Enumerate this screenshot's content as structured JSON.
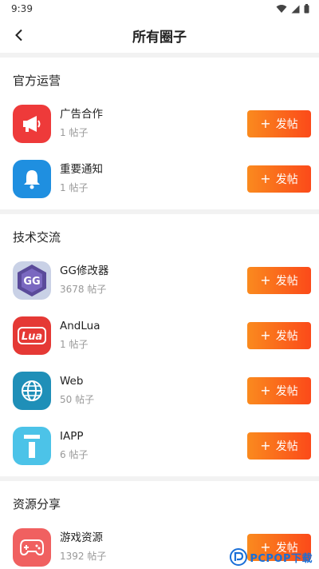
{
  "status": {
    "time": "9:39"
  },
  "header": {
    "title": "所有圈子"
  },
  "sections": [
    {
      "title": "官方运营",
      "items": [
        {
          "name": "广告合作",
          "count": "1 帖子",
          "button": "发帖",
          "icon": "megaphone-icon",
          "color": "#ee3a3a"
        },
        {
          "name": "重要通知",
          "count": "1 帖子",
          "button": "发帖",
          "icon": "bell-icon",
          "color": "#1f8fe0"
        }
      ]
    },
    {
      "title": "技术交流",
      "items": [
        {
          "name": "GG修改器",
          "count": "3678 帖子",
          "button": "发帖",
          "icon": "gg-logo-icon",
          "color": "#5a4a9a"
        },
        {
          "name": "AndLua",
          "count": "1 帖子",
          "button": "发帖",
          "icon": "lua-logo-icon",
          "color": "#e53935"
        },
        {
          "name": "Web",
          "count": "50 帖子",
          "button": "发帖",
          "icon": "globe-icon",
          "color": "#1f8fb8"
        },
        {
          "name": "IAPP",
          "count": "6 帖子",
          "button": "发帖",
          "icon": "info-i-icon",
          "color": "#4cc3e8"
        }
      ]
    },
    {
      "title": "资源分享",
      "items": [
        {
          "name": "游戏资源",
          "count": "1392 帖子",
          "button": "发帖",
          "icon": "gamepad-icon",
          "color": "#f06060"
        }
      ]
    }
  ],
  "watermark": {
    "text": "PCPOP下载"
  }
}
